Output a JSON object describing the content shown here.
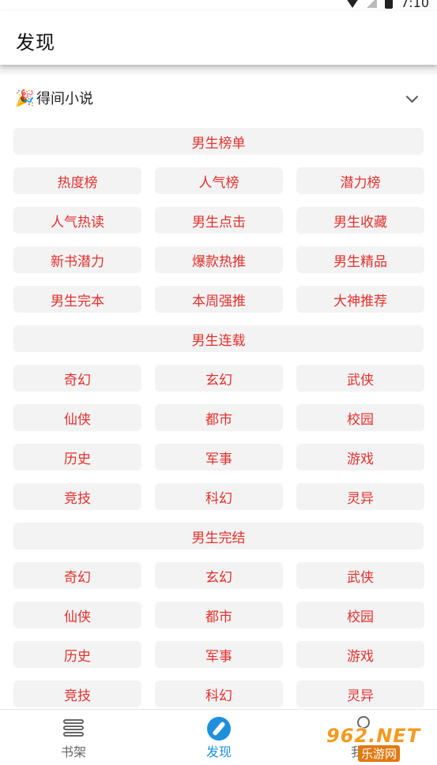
{
  "status_bar": {
    "time": "7:10"
  },
  "header": {
    "title": "发现"
  },
  "source": {
    "name": "得间小说",
    "icon": "party-popper-icon"
  },
  "sections": [
    {
      "title": "男生榜单",
      "items": [
        "热度榜",
        "人气榜",
        "潜力榜",
        "人气热读",
        "男生点击",
        "男生收藏",
        "新书潜力",
        "爆款热推",
        "男生精品",
        "男生完本",
        "本周强推",
        "大神推荐"
      ]
    },
    {
      "title": "男生连载",
      "items": [
        "奇幻",
        "玄幻",
        "武侠",
        "仙侠",
        "都市",
        "校园",
        "历史",
        "军事",
        "游戏",
        "竞技",
        "科幻",
        "灵异"
      ]
    },
    {
      "title": "男生完结",
      "items": [
        "奇幻",
        "玄幻",
        "武侠",
        "仙侠",
        "都市",
        "校园",
        "历史",
        "军事",
        "游戏",
        "竞技",
        "科幻",
        "灵异"
      ]
    }
  ],
  "bottom_nav": {
    "shelf": "书架",
    "discover": "发现",
    "mine": "我的"
  },
  "watermark": {
    "top": "962.NET",
    "bottom": "乐游网"
  },
  "colors": {
    "accent": "#e0312d",
    "active_tab": "#1f8fdc",
    "chip_bg": "#f3f3f3"
  }
}
